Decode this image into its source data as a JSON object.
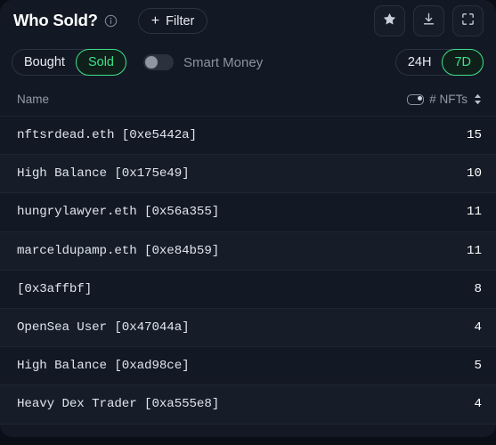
{
  "header": {
    "title": "Who Sold?",
    "info_icon": "info-circle-icon",
    "filter_label": "Filter",
    "filter_plus": "+",
    "actions": [
      {
        "name": "favorite-button",
        "icon": "star-icon"
      },
      {
        "name": "download-button",
        "icon": "download-icon"
      },
      {
        "name": "fullscreen-button",
        "icon": "fullscreen-icon"
      }
    ]
  },
  "controls": {
    "side_toggle": {
      "options": [
        "Bought",
        "Sold"
      ],
      "selected": "Sold"
    },
    "smart_money": {
      "label": "Smart Money",
      "enabled": false,
      "icon": "toggle-switch-icon"
    },
    "timeframe": {
      "options": [
        "24H",
        "7D"
      ],
      "selected": "7D"
    }
  },
  "table": {
    "columns": {
      "name": "Name",
      "metric": "# NFTs",
      "metric_toggle_icon": "mini-toggle-icon",
      "sort_icon": "sort-arrows-icon"
    },
    "rows": [
      {
        "name": "nftsrdead.eth [0xe5442a]",
        "value": "15"
      },
      {
        "name": "High Balance [0x175e49]",
        "value": "10"
      },
      {
        "name": "hungrylawyer.eth [0x56a355]",
        "value": "11"
      },
      {
        "name": "marceldupamp.eth [0xe84b59]",
        "value": "11"
      },
      {
        "name": "[0x3affbf]",
        "value": "8"
      },
      {
        "name": "OpenSea User [0x47044a]",
        "value": "4"
      },
      {
        "name": "High Balance [0xad98ce]",
        "value": "5"
      },
      {
        "name": "Heavy Dex Trader [0xa555e8]",
        "value": "4"
      }
    ]
  },
  "colors": {
    "accent_green": "#3fe08a",
    "card_background": "#131924",
    "row_alt_background": "#161d28",
    "page_background": "#0a0e16",
    "muted_text": "#8b93a1"
  }
}
